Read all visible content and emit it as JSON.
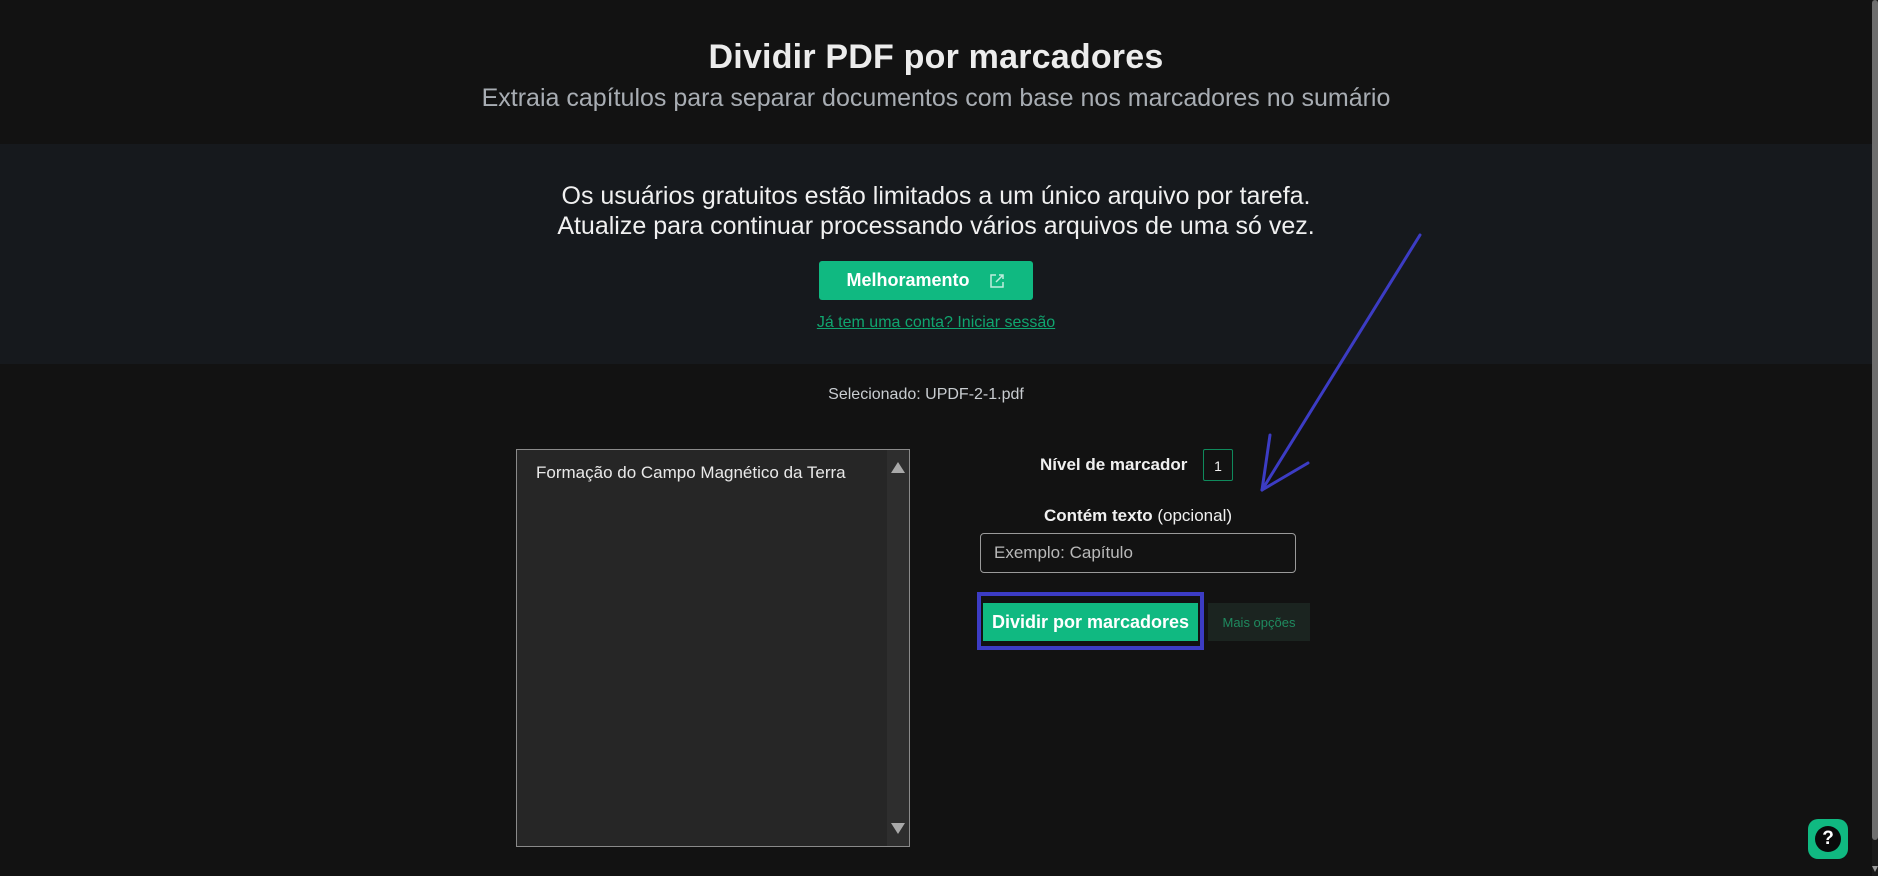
{
  "header": {
    "title": "Dividir PDF por marcadores",
    "subtitle": "Extraia capítulos para separar documentos com base nos marcadores no sumário"
  },
  "banner": {
    "line1": "Os usuários gratuitos estão limitados a um único arquivo por tarefa.",
    "line2": "Atualize para continuar processando vários arquivos de uma só vez.",
    "upgrade_label": "Melhoramento",
    "upgrade_icon": "external-link-icon",
    "login_link": "Já tem uma conta? Iniciar sessão"
  },
  "selected_file": "Selecionado: UPDF-2-1.pdf",
  "bookmarks": {
    "items": [
      "Formação do Campo Magnético da Terra"
    ]
  },
  "options": {
    "level_label": "Nível de marcador",
    "level_value": "1",
    "contains_label": "Contém texto",
    "contains_optional": "(opcional)",
    "contains_placeholder": "Exemplo: Capítulo"
  },
  "actions": {
    "split_label": "Dividir por marcadores",
    "more_label": "Mais opções"
  },
  "help": {
    "icon": "question-icon",
    "glyph": "?"
  },
  "colors": {
    "accent": "#10b981",
    "annotation": "#3c3cc4",
    "background": "#121212",
    "banner_bg": "#16191d"
  }
}
